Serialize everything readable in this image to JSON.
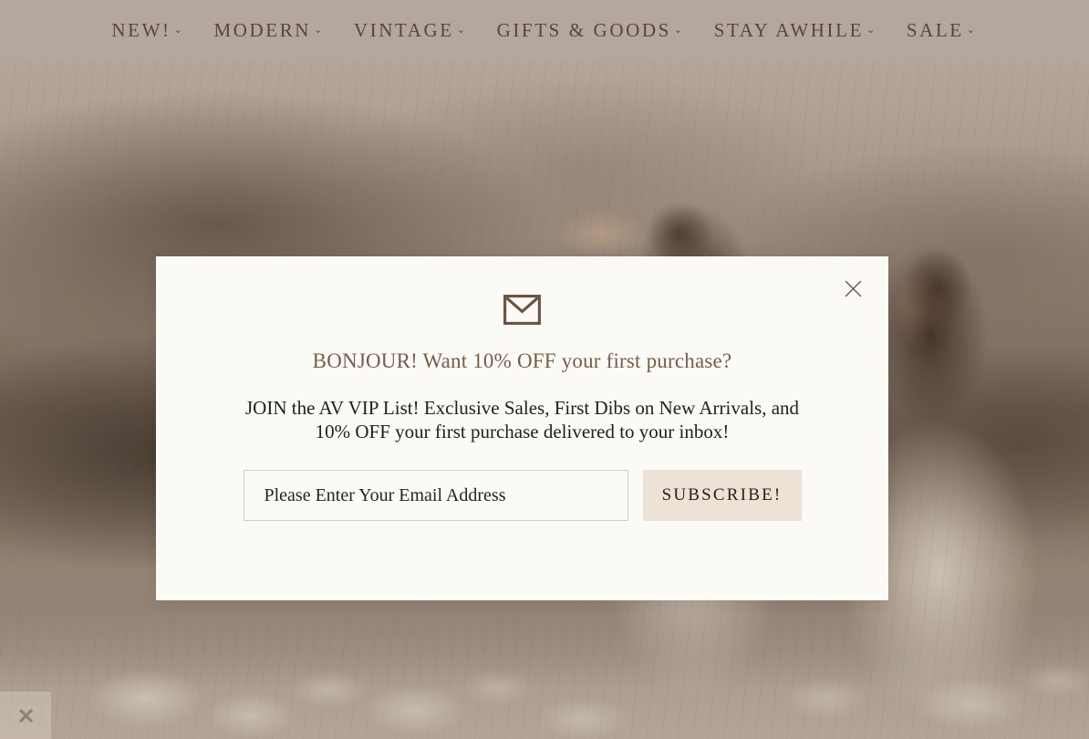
{
  "nav": {
    "items": [
      {
        "label": "NEW!",
        "caret": "⌄",
        "has_dropdown": true
      },
      {
        "label": "MODERN",
        "caret": "⌄",
        "has_dropdown": true
      },
      {
        "label": "VINTAGE",
        "caret": "⌄",
        "has_dropdown": true
      },
      {
        "label": "GIFTS & GOODS",
        "caret": "⌄",
        "has_dropdown": true
      },
      {
        "label": "STAY AWHILE",
        "caret": "⌄",
        "has_dropdown": true
      },
      {
        "label": "SALE",
        "caret": "⌄",
        "has_dropdown": true
      }
    ],
    "background_color": "#b3a79f",
    "text_color": "#5d4436"
  },
  "hero": {
    "description": "Sepia-toned photograph of two women with long dark hair standing in a wildflower meadow beside a lake with hazy mountains behind",
    "alt": "Two women in cream dresses in a mountain meadow"
  },
  "modal": {
    "icon": "envelope-icon",
    "close_label": "×",
    "heading": "BONJOUR! Want 10% OFF your first purchase?",
    "body": "JOIN the AV VIP List! Exclusive Sales, First Dibs on New Arrivals, and 10% OFF your first purchase delivered to your inbox!",
    "email_placeholder": "Please Enter Your Email Address",
    "email_value": "",
    "subscribe_label": "SUBSCRIBE!",
    "background_color": "#fbfaf7",
    "heading_color": "#7a5c44",
    "button_color": "#ece3d6",
    "icon_color": "#6b5142"
  },
  "corner_widget": {
    "icon": "close-x-icon",
    "label": "✕"
  }
}
